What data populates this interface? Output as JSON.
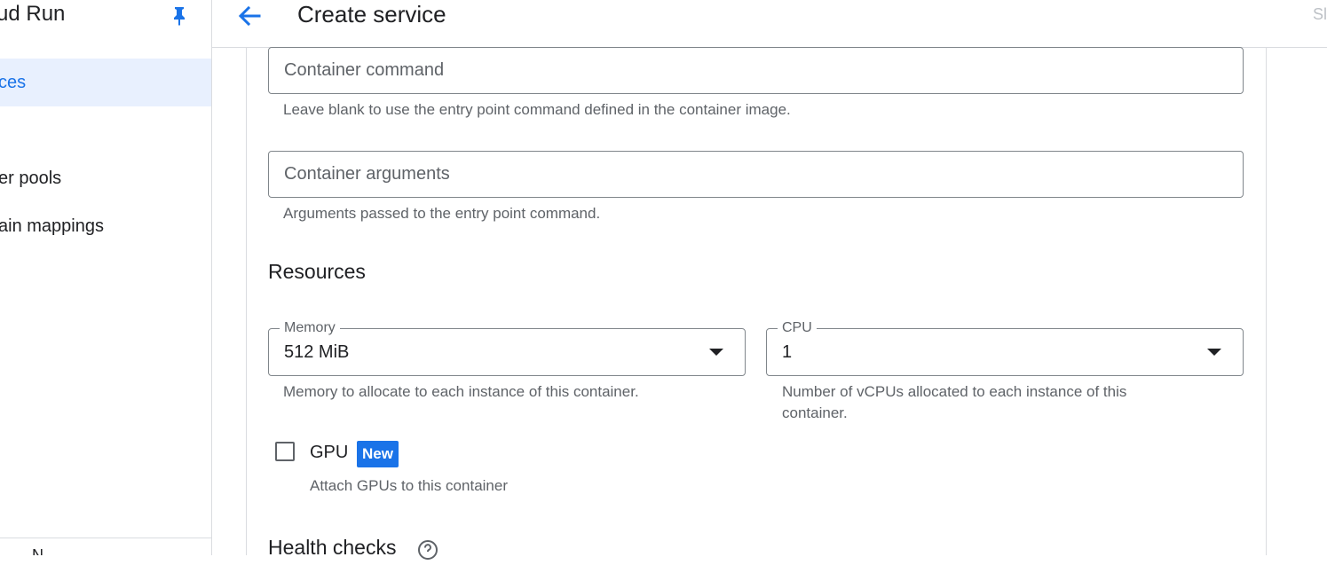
{
  "sidebar": {
    "title": "ud Run",
    "items": [
      {
        "label": "ces",
        "active": true
      },
      {
        "label": "er pools",
        "active": false
      },
      {
        "label": "ain mappings",
        "active": false
      }
    ],
    "bottom_text": "N"
  },
  "header": {
    "title": "Create service",
    "right_text": "Sl"
  },
  "form": {
    "container_command": {
      "placeholder": "Container command",
      "hint": "Leave blank to use the entry point command defined in the container image."
    },
    "container_arguments": {
      "placeholder": "Container arguments",
      "hint": "Arguments passed to the entry point command."
    },
    "resources": {
      "heading": "Resources",
      "memory": {
        "label": "Memory",
        "value": "512 MiB",
        "hint": "Memory to allocate to each instance of this container."
      },
      "cpu": {
        "label": "CPU",
        "value": "1",
        "hint_line1": "Number of vCPUs allocated to each instance of this",
        "hint_line2": "container."
      },
      "gpu": {
        "label": "GPU",
        "badge": "New",
        "checked": false,
        "hint": "Attach GPUs to this container"
      }
    },
    "health_checks": {
      "heading": "Health checks"
    }
  },
  "colors": {
    "accent": "#1a73e8",
    "active_bg": "#e8f0fe",
    "border": "#80868b",
    "divider": "#dadce0",
    "hint_text": "#5f6368"
  }
}
